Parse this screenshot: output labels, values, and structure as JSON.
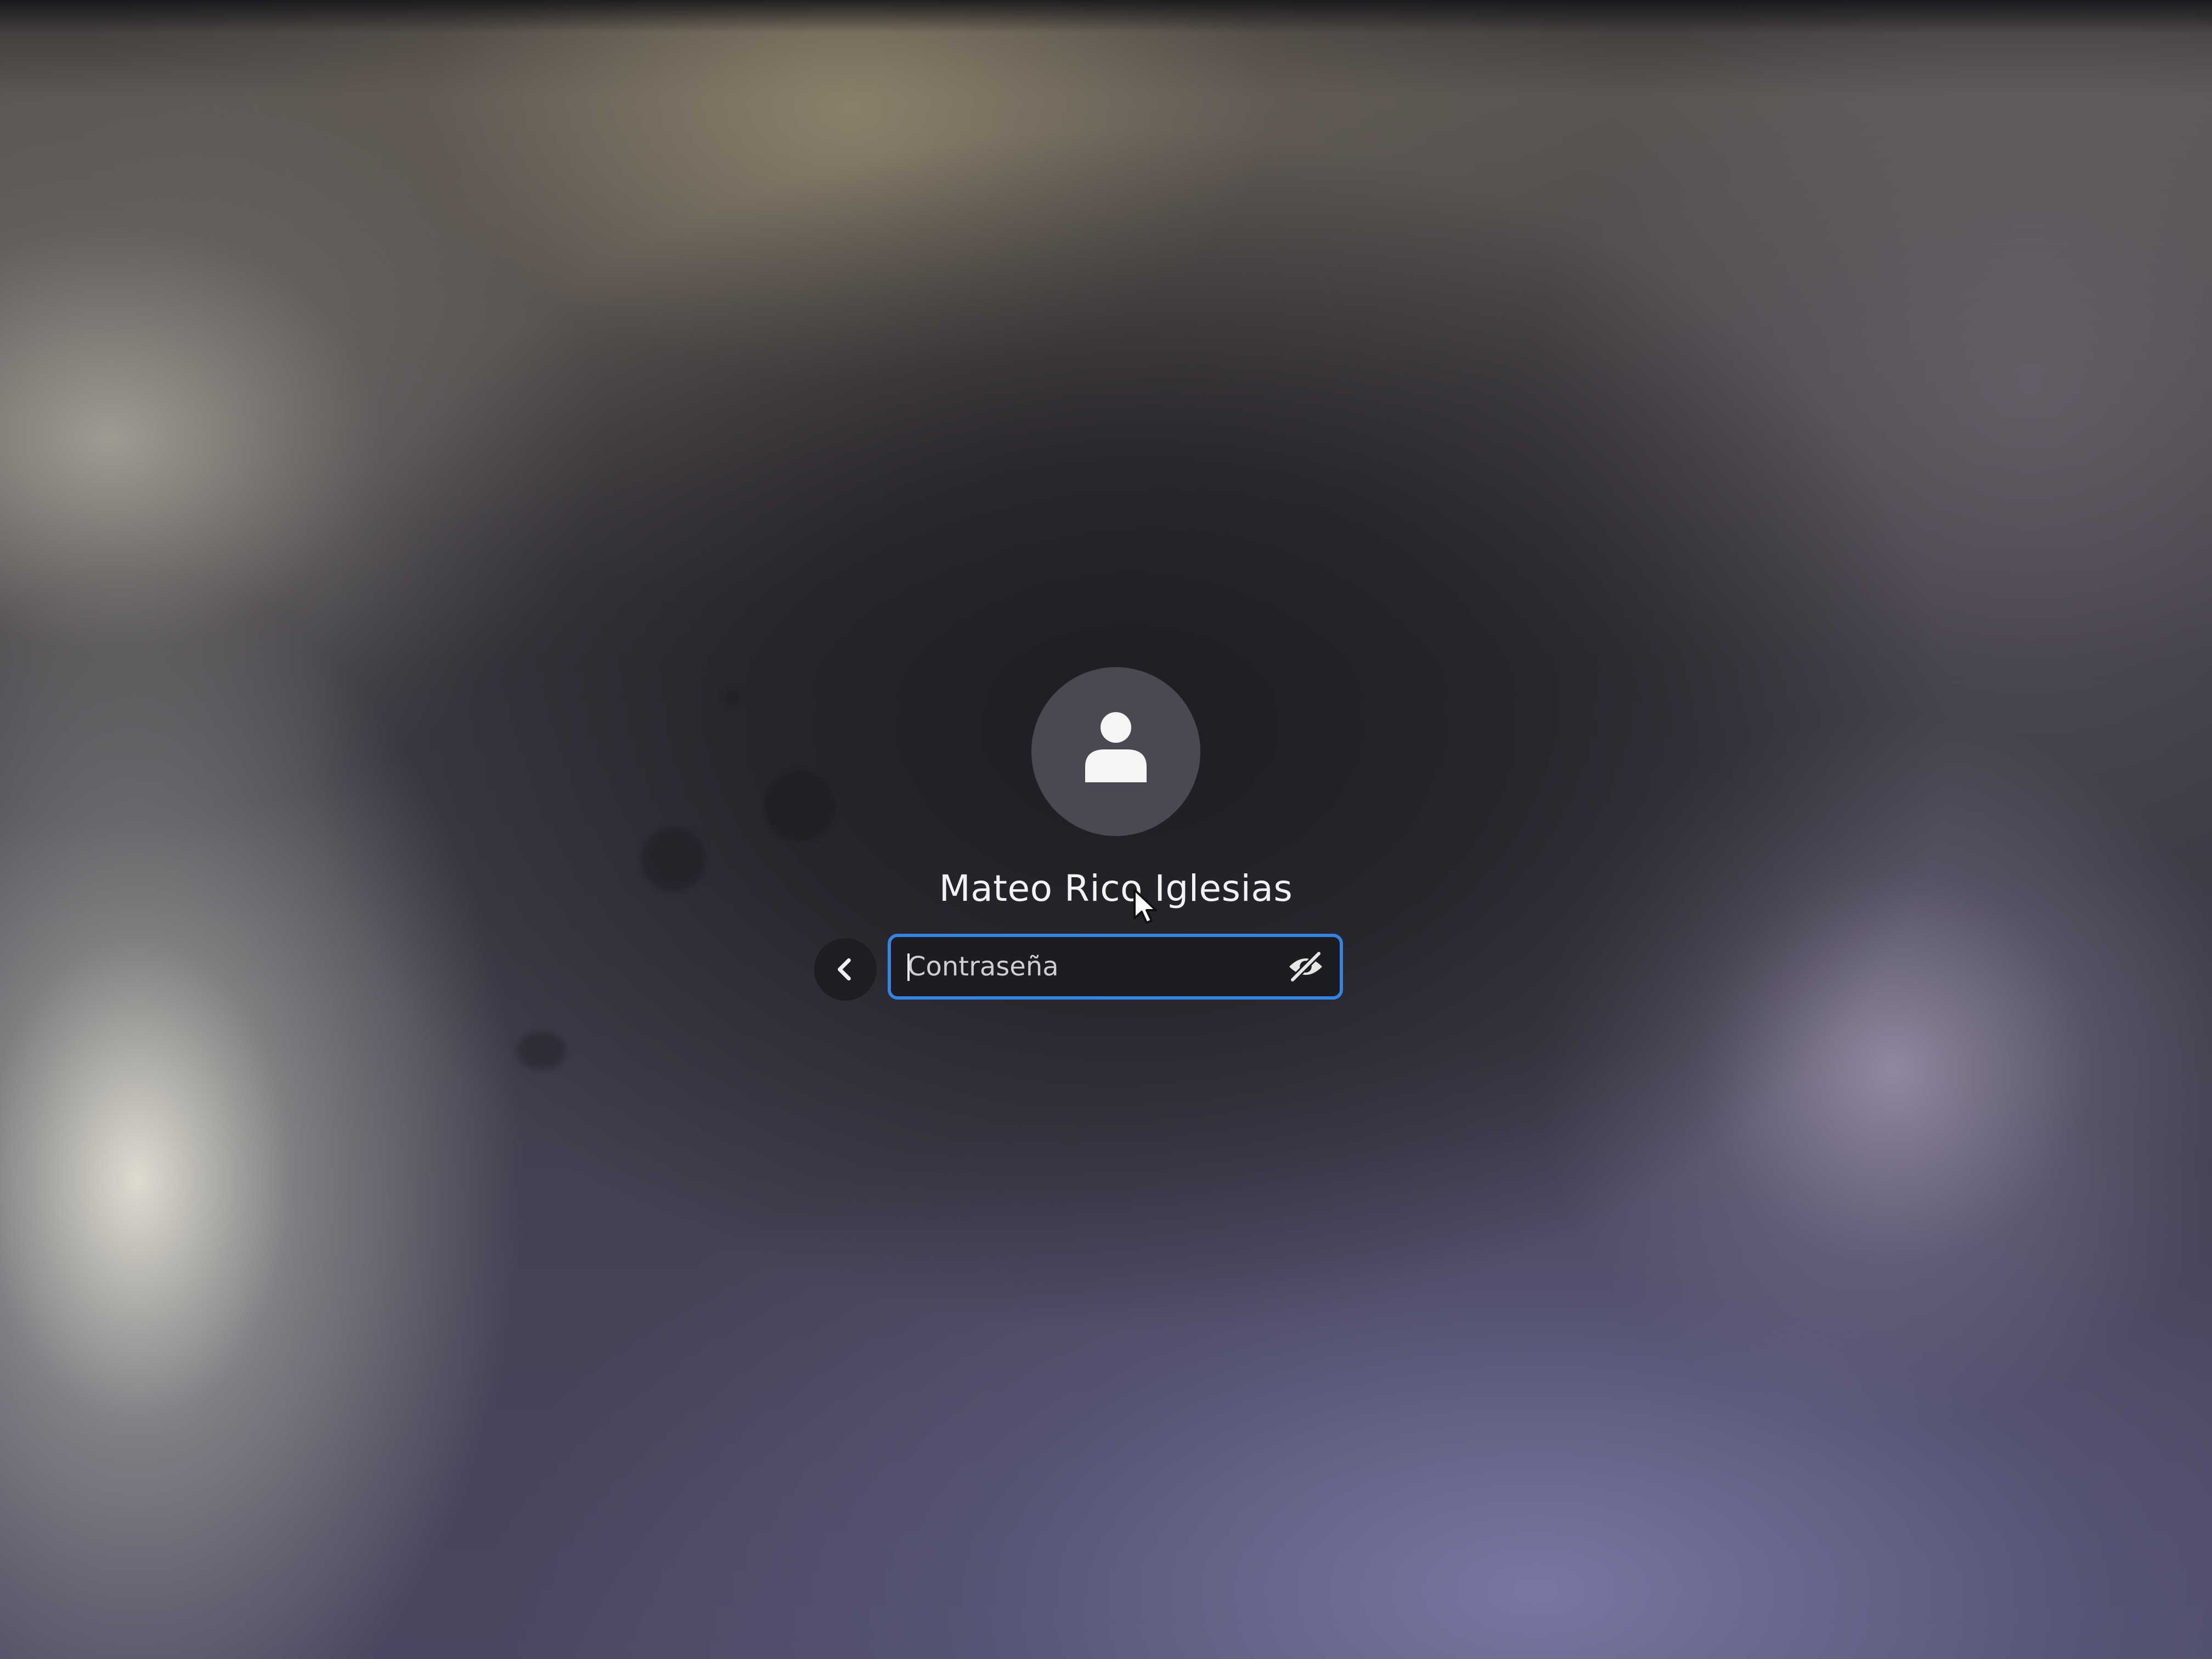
{
  "login": {
    "avatar_icon": "user-avatar-icon",
    "user_name": "Mateo Rico Iglesias",
    "back_icon": "chevron-left-icon",
    "password": {
      "placeholder": "Contraseña",
      "value": "",
      "reveal_icon": "eye-slash-icon"
    },
    "pointer_icon": "mouse-pointer-icon"
  },
  "colors": {
    "focus_accent": "#3584e4",
    "entry_background": "#1d1d21",
    "avatar_background": "#4a4850",
    "text": "#f2f2f2"
  }
}
